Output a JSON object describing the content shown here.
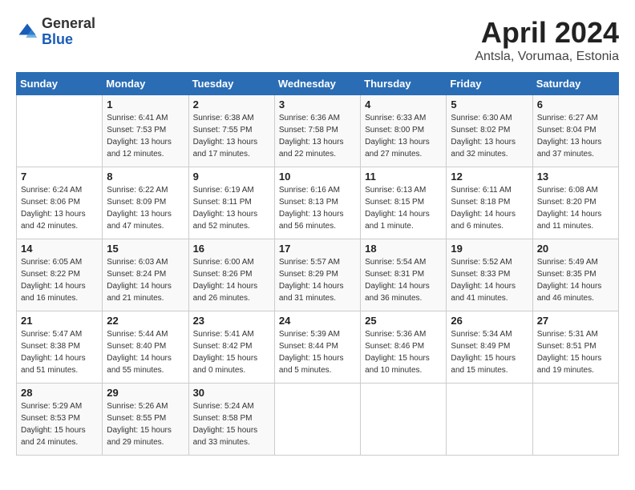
{
  "logo": {
    "general": "General",
    "blue": "Blue"
  },
  "header": {
    "title": "April 2024",
    "location": "Antsla, Vorumaa, Estonia"
  },
  "days_of_week": [
    "Sunday",
    "Monday",
    "Tuesday",
    "Wednesday",
    "Thursday",
    "Friday",
    "Saturday"
  ],
  "weeks": [
    [
      {
        "day": "",
        "sunrise": "",
        "sunset": "",
        "daylight": ""
      },
      {
        "day": "1",
        "sunrise": "Sunrise: 6:41 AM",
        "sunset": "Sunset: 7:53 PM",
        "daylight": "Daylight: 13 hours and 12 minutes."
      },
      {
        "day": "2",
        "sunrise": "Sunrise: 6:38 AM",
        "sunset": "Sunset: 7:55 PM",
        "daylight": "Daylight: 13 hours and 17 minutes."
      },
      {
        "day": "3",
        "sunrise": "Sunrise: 6:36 AM",
        "sunset": "Sunset: 7:58 PM",
        "daylight": "Daylight: 13 hours and 22 minutes."
      },
      {
        "day": "4",
        "sunrise": "Sunrise: 6:33 AM",
        "sunset": "Sunset: 8:00 PM",
        "daylight": "Daylight: 13 hours and 27 minutes."
      },
      {
        "day": "5",
        "sunrise": "Sunrise: 6:30 AM",
        "sunset": "Sunset: 8:02 PM",
        "daylight": "Daylight: 13 hours and 32 minutes."
      },
      {
        "day": "6",
        "sunrise": "Sunrise: 6:27 AM",
        "sunset": "Sunset: 8:04 PM",
        "daylight": "Daylight: 13 hours and 37 minutes."
      }
    ],
    [
      {
        "day": "7",
        "sunrise": "Sunrise: 6:24 AM",
        "sunset": "Sunset: 8:06 PM",
        "daylight": "Daylight: 13 hours and 42 minutes."
      },
      {
        "day": "8",
        "sunrise": "Sunrise: 6:22 AM",
        "sunset": "Sunset: 8:09 PM",
        "daylight": "Daylight: 13 hours and 47 minutes."
      },
      {
        "day": "9",
        "sunrise": "Sunrise: 6:19 AM",
        "sunset": "Sunset: 8:11 PM",
        "daylight": "Daylight: 13 hours and 52 minutes."
      },
      {
        "day": "10",
        "sunrise": "Sunrise: 6:16 AM",
        "sunset": "Sunset: 8:13 PM",
        "daylight": "Daylight: 13 hours and 56 minutes."
      },
      {
        "day": "11",
        "sunrise": "Sunrise: 6:13 AM",
        "sunset": "Sunset: 8:15 PM",
        "daylight": "Daylight: 14 hours and 1 minute."
      },
      {
        "day": "12",
        "sunrise": "Sunrise: 6:11 AM",
        "sunset": "Sunset: 8:18 PM",
        "daylight": "Daylight: 14 hours and 6 minutes."
      },
      {
        "day": "13",
        "sunrise": "Sunrise: 6:08 AM",
        "sunset": "Sunset: 8:20 PM",
        "daylight": "Daylight: 14 hours and 11 minutes."
      }
    ],
    [
      {
        "day": "14",
        "sunrise": "Sunrise: 6:05 AM",
        "sunset": "Sunset: 8:22 PM",
        "daylight": "Daylight: 14 hours and 16 minutes."
      },
      {
        "day": "15",
        "sunrise": "Sunrise: 6:03 AM",
        "sunset": "Sunset: 8:24 PM",
        "daylight": "Daylight: 14 hours and 21 minutes."
      },
      {
        "day": "16",
        "sunrise": "Sunrise: 6:00 AM",
        "sunset": "Sunset: 8:26 PM",
        "daylight": "Daylight: 14 hours and 26 minutes."
      },
      {
        "day": "17",
        "sunrise": "Sunrise: 5:57 AM",
        "sunset": "Sunset: 8:29 PM",
        "daylight": "Daylight: 14 hours and 31 minutes."
      },
      {
        "day": "18",
        "sunrise": "Sunrise: 5:54 AM",
        "sunset": "Sunset: 8:31 PM",
        "daylight": "Daylight: 14 hours and 36 minutes."
      },
      {
        "day": "19",
        "sunrise": "Sunrise: 5:52 AM",
        "sunset": "Sunset: 8:33 PM",
        "daylight": "Daylight: 14 hours and 41 minutes."
      },
      {
        "day": "20",
        "sunrise": "Sunrise: 5:49 AM",
        "sunset": "Sunset: 8:35 PM",
        "daylight": "Daylight: 14 hours and 46 minutes."
      }
    ],
    [
      {
        "day": "21",
        "sunrise": "Sunrise: 5:47 AM",
        "sunset": "Sunset: 8:38 PM",
        "daylight": "Daylight: 14 hours and 51 minutes."
      },
      {
        "day": "22",
        "sunrise": "Sunrise: 5:44 AM",
        "sunset": "Sunset: 8:40 PM",
        "daylight": "Daylight: 14 hours and 55 minutes."
      },
      {
        "day": "23",
        "sunrise": "Sunrise: 5:41 AM",
        "sunset": "Sunset: 8:42 PM",
        "daylight": "Daylight: 15 hours and 0 minutes."
      },
      {
        "day": "24",
        "sunrise": "Sunrise: 5:39 AM",
        "sunset": "Sunset: 8:44 PM",
        "daylight": "Daylight: 15 hours and 5 minutes."
      },
      {
        "day": "25",
        "sunrise": "Sunrise: 5:36 AM",
        "sunset": "Sunset: 8:46 PM",
        "daylight": "Daylight: 15 hours and 10 minutes."
      },
      {
        "day": "26",
        "sunrise": "Sunrise: 5:34 AM",
        "sunset": "Sunset: 8:49 PM",
        "daylight": "Daylight: 15 hours and 15 minutes."
      },
      {
        "day": "27",
        "sunrise": "Sunrise: 5:31 AM",
        "sunset": "Sunset: 8:51 PM",
        "daylight": "Daylight: 15 hours and 19 minutes."
      }
    ],
    [
      {
        "day": "28",
        "sunrise": "Sunrise: 5:29 AM",
        "sunset": "Sunset: 8:53 PM",
        "daylight": "Daylight: 15 hours and 24 minutes."
      },
      {
        "day": "29",
        "sunrise": "Sunrise: 5:26 AM",
        "sunset": "Sunset: 8:55 PM",
        "daylight": "Daylight: 15 hours and 29 minutes."
      },
      {
        "day": "30",
        "sunrise": "Sunrise: 5:24 AM",
        "sunset": "Sunset: 8:58 PM",
        "daylight": "Daylight: 15 hours and 33 minutes."
      },
      {
        "day": "",
        "sunrise": "",
        "sunset": "",
        "daylight": ""
      },
      {
        "day": "",
        "sunrise": "",
        "sunset": "",
        "daylight": ""
      },
      {
        "day": "",
        "sunrise": "",
        "sunset": "",
        "daylight": ""
      },
      {
        "day": "",
        "sunrise": "",
        "sunset": "",
        "daylight": ""
      }
    ]
  ]
}
